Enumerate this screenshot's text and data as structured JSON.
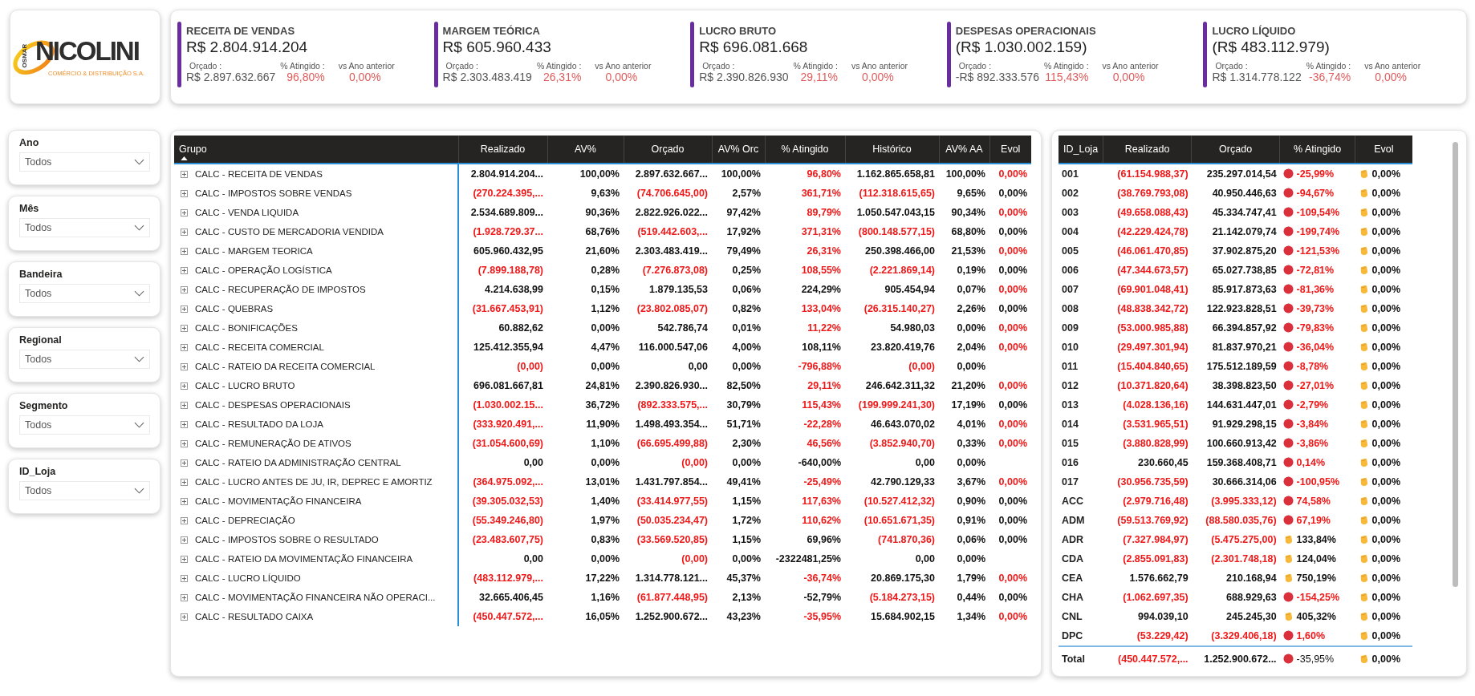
{
  "logo": {
    "prefix": "OSMAR",
    "name": "NICOLINI",
    "tagline": "COMÉRCIO & DISTRIBUIÇÃO S.A."
  },
  "kpis": [
    {
      "title": "RECEITA DE VENDAS",
      "value": "R$ 2.804.914.204",
      "budget_label": "Orçado :",
      "budget": "R$ 2.897.632.667",
      "pct_label": "% Atingido :",
      "pct": "96,80%",
      "prev_label": "vs Ano anterior",
      "prev": "0,00%"
    },
    {
      "title": "MARGEM TEÓRICA",
      "value": "R$ 605.960.433",
      "budget_label": "Orçado :",
      "budget": "R$ 2.303.483.419",
      "pct_label": "% Atingido :",
      "pct": "26,31%",
      "prev_label": "vs Ano anterior",
      "prev": "0,00%"
    },
    {
      "title": "LUCRO BRUTO",
      "value": "R$ 696.081.668",
      "budget_label": "Orçado :",
      "budget": "R$ 2.390.826.930",
      "pct_label": "% Atingido :",
      "pct": "29,11%",
      "prev_label": "vs Ano anterior",
      "prev": "0,00%"
    },
    {
      "title": "DESPESAS OPERACIONAIS",
      "value": "(R$ 1.030.002.159)",
      "budget_label": "Orçado :",
      "budget": "-R$ 892.333.576",
      "pct_label": "% Atingido :",
      "pct": "115,43%",
      "prev_label": "vs Ano anterior",
      "prev": "0,00%"
    },
    {
      "title": "LUCRO LÍQUIDO",
      "value": "(R$ 483.112.979)",
      "budget_label": "Orçado :",
      "budget": "R$ 1.314.778.122",
      "pct_label": "% Atingido :",
      "pct": "-36,74%",
      "prev_label": "vs Ano anterior",
      "prev": "0,00%"
    }
  ],
  "filters": [
    {
      "label": "Ano",
      "value": "Todos"
    },
    {
      "label": "Mês",
      "value": "Todos"
    },
    {
      "label": "Bandeira",
      "value": "Todos"
    },
    {
      "label": "Regional",
      "value": "Todos"
    },
    {
      "label": "Segmento",
      "value": "Todos"
    },
    {
      "label": "ID_Loja",
      "value": "Todos"
    }
  ],
  "main_table": {
    "columns": [
      {
        "label": "Grupo",
        "sorted": true
      },
      {
        "label": "Realizado",
        "sorted": false
      },
      {
        "label": "AV%",
        "sorted": false
      },
      {
        "label": "Orçado",
        "sorted": false
      },
      {
        "label": "AV% Orc",
        "sorted": false
      },
      {
        "label": "% Atingido",
        "sorted": false
      },
      {
        "label": "Histórico",
        "sorted": false
      },
      {
        "label": "AV% AA",
        "sorted": false
      },
      {
        "label": "Evol",
        "sorted": false
      }
    ],
    "rows": [
      {
        "cells": [
          {
            "v": "CALC - RECEITA DE VENDAS",
            "red": false
          },
          {
            "v": "2.804.914.204...",
            "red": false
          },
          {
            "v": "100,00%",
            "red": false
          },
          {
            "v": "2.897.632.667...",
            "red": false
          },
          {
            "v": "100,00%",
            "red": false
          },
          {
            "v": "96,80%",
            "red": true
          },
          {
            "v": "1.162.865.658,81",
            "red": false
          },
          {
            "v": "100,00%",
            "red": false
          },
          {
            "v": "0,00%",
            "red": true
          }
        ]
      },
      {
        "cells": [
          {
            "v": "CALC - IMPOSTOS SOBRE VENDAS",
            "red": false
          },
          {
            "v": "(270.224.395,...",
            "red": true
          },
          {
            "v": "9,63%",
            "red": false
          },
          {
            "v": "(74.706.645,00)",
            "red": true
          },
          {
            "v": "2,57%",
            "red": false
          },
          {
            "v": "361,71%",
            "red": true
          },
          {
            "v": "(112.318.615,65)",
            "red": true
          },
          {
            "v": "9,65%",
            "red": false
          },
          {
            "v": "0,00%",
            "red": false
          }
        ]
      },
      {
        "cells": [
          {
            "v": "CALC - VENDA LIQUIDA",
            "red": false
          },
          {
            "v": "2.534.689.809...",
            "red": false
          },
          {
            "v": "90,36%",
            "red": false
          },
          {
            "v": "2.822.926.022...",
            "red": false
          },
          {
            "v": "97,42%",
            "red": false
          },
          {
            "v": "89,79%",
            "red": true
          },
          {
            "v": "1.050.547.043,15",
            "red": false
          },
          {
            "v": "90,34%",
            "red": false
          },
          {
            "v": "0,00%",
            "red": true
          }
        ]
      },
      {
        "cells": [
          {
            "v": "CALC - CUSTO DE MERCADORIA VENDIDA",
            "red": false
          },
          {
            "v": "(1.928.729.37...",
            "red": true
          },
          {
            "v": "68,76%",
            "red": false
          },
          {
            "v": "(519.442.603,...",
            "red": true
          },
          {
            "v": "17,92%",
            "red": false
          },
          {
            "v": "371,31%",
            "red": true
          },
          {
            "v": "(800.148.577,15)",
            "red": true
          },
          {
            "v": "68,80%",
            "red": false
          },
          {
            "v": "0,00%",
            "red": false
          }
        ]
      },
      {
        "cells": [
          {
            "v": "CALC - MARGEM TEORICA",
            "red": false
          },
          {
            "v": "605.960.432,95",
            "red": false
          },
          {
            "v": "21,60%",
            "red": false
          },
          {
            "v": "2.303.483.419...",
            "red": false
          },
          {
            "v": "79,49%",
            "red": false
          },
          {
            "v": "26,31%",
            "red": true
          },
          {
            "v": "250.398.466,00",
            "red": false
          },
          {
            "v": "21,53%",
            "red": false
          },
          {
            "v": "0,00%",
            "red": true
          }
        ]
      },
      {
        "cells": [
          {
            "v": "CALC - OPERAÇÃO LOGÍSTICA",
            "red": false
          },
          {
            "v": "(7.899.188,78)",
            "red": true
          },
          {
            "v": "0,28%",
            "red": false
          },
          {
            "v": "(7.276.873,08)",
            "red": true
          },
          {
            "v": "0,25%",
            "red": false
          },
          {
            "v": "108,55%",
            "red": true
          },
          {
            "v": "(2.221.869,14)",
            "red": true
          },
          {
            "v": "0,19%",
            "red": false
          },
          {
            "v": "0,00%",
            "red": false
          }
        ]
      },
      {
        "cells": [
          {
            "v": "CALC - RECUPERAÇÃO DE IMPOSTOS",
            "red": false
          },
          {
            "v": "4.214.638,99",
            "red": false
          },
          {
            "v": "0,15%",
            "red": false
          },
          {
            "v": "1.879.135,53",
            "red": false
          },
          {
            "v": "0,06%",
            "red": false
          },
          {
            "v": "224,29%",
            "red": false
          },
          {
            "v": "905.454,94",
            "red": false
          },
          {
            "v": "0,07%",
            "red": false
          },
          {
            "v": "0,00%",
            "red": true
          }
        ]
      },
      {
        "cells": [
          {
            "v": "CALC - QUEBRAS",
            "red": false
          },
          {
            "v": "(31.667.453,91)",
            "red": true
          },
          {
            "v": "1,12%",
            "red": false
          },
          {
            "v": "(23.802.085,07)",
            "red": true
          },
          {
            "v": "0,82%",
            "red": false
          },
          {
            "v": "133,04%",
            "red": true
          },
          {
            "v": "(26.315.140,27)",
            "red": true
          },
          {
            "v": "2,26%",
            "red": false
          },
          {
            "v": "0,00%",
            "red": false
          }
        ]
      },
      {
        "cells": [
          {
            "v": "CALC - BONIFICAÇÕES",
            "red": false
          },
          {
            "v": "60.882,62",
            "red": false
          },
          {
            "v": "0,00%",
            "red": false
          },
          {
            "v": "542.786,74",
            "red": false
          },
          {
            "v": "0,01%",
            "red": false
          },
          {
            "v": "11,22%",
            "red": true
          },
          {
            "v": "54.980,03",
            "red": false
          },
          {
            "v": "0,00%",
            "red": false
          },
          {
            "v": "0,00%",
            "red": true
          }
        ]
      },
      {
        "cells": [
          {
            "v": "CALC - RECEITA COMERCIAL",
            "red": false
          },
          {
            "v": "125.412.355,94",
            "red": false
          },
          {
            "v": "4,47%",
            "red": false
          },
          {
            "v": "116.000.547,06",
            "red": false
          },
          {
            "v": "4,00%",
            "red": false
          },
          {
            "v": "108,11%",
            "red": false
          },
          {
            "v": "23.820.419,76",
            "red": false
          },
          {
            "v": "2,04%",
            "red": false
          },
          {
            "v": "0,00%",
            "red": true
          }
        ]
      },
      {
        "cells": [
          {
            "v": "CALC - RATEIO DA RECEITA COMERCIAL",
            "red": false
          },
          {
            "v": "(0,00)",
            "red": true
          },
          {
            "v": "0,00%",
            "red": false
          },
          {
            "v": "0,00",
            "red": false
          },
          {
            "v": "0,00%",
            "red": false
          },
          {
            "v": "-796,88%",
            "red": true
          },
          {
            "v": "(0,00)",
            "red": true
          },
          {
            "v": "0,00%",
            "red": false
          }
        ]
      },
      {
        "cells": [
          {
            "v": "CALC - LUCRO BRUTO",
            "red": false
          },
          {
            "v": "696.081.667,81",
            "red": false
          },
          {
            "v": "24,81%",
            "red": false
          },
          {
            "v": "2.390.826.930...",
            "red": false
          },
          {
            "v": "82,50%",
            "red": false
          },
          {
            "v": "29,11%",
            "red": true
          },
          {
            "v": "246.642.311,32",
            "red": false
          },
          {
            "v": "21,20%",
            "red": false
          },
          {
            "v": "0,00%",
            "red": true
          }
        ]
      },
      {
        "cells": [
          {
            "v": "CALC - DESPESAS OPERACIONAIS",
            "red": false
          },
          {
            "v": "(1.030.002.15...",
            "red": true
          },
          {
            "v": "36,72%",
            "red": false
          },
          {
            "v": "(892.333.575,...",
            "red": true
          },
          {
            "v": "30,79%",
            "red": false
          },
          {
            "v": "115,43%",
            "red": true
          },
          {
            "v": "(199.999.241,30)",
            "red": true
          },
          {
            "v": "17,19%",
            "red": false
          },
          {
            "v": "0,00%",
            "red": false
          }
        ]
      },
      {
        "cells": [
          {
            "v": "CALC - RESULTADO DA LOJA",
            "red": false
          },
          {
            "v": "(333.920.491,...",
            "red": true
          },
          {
            "v": "11,90%",
            "red": false
          },
          {
            "v": "1.498.493.354...",
            "red": false
          },
          {
            "v": "51,71%",
            "red": false
          },
          {
            "v": "-22,28%",
            "red": true
          },
          {
            "v": "46.643.070,02",
            "red": false
          },
          {
            "v": "4,01%",
            "red": false
          },
          {
            "v": "0,00%",
            "red": true
          }
        ]
      },
      {
        "cells": [
          {
            "v": "CALC - REMUNERAÇÃO DE ATIVOS",
            "red": false
          },
          {
            "v": "(31.054.600,69)",
            "red": true
          },
          {
            "v": "1,10%",
            "red": false
          },
          {
            "v": "(66.695.499,88)",
            "red": true
          },
          {
            "v": "2,30%",
            "red": false
          },
          {
            "v": "46,56%",
            "red": true
          },
          {
            "v": "(3.852.940,70)",
            "red": true
          },
          {
            "v": "0,33%",
            "red": false
          },
          {
            "v": "0,00%",
            "red": true
          }
        ]
      },
      {
        "cells": [
          {
            "v": "CALC - RATEIO DA ADMINISTRAÇÃO CENTRAL",
            "red": false
          },
          {
            "v": "0,00",
            "red": false
          },
          {
            "v": "0,00%",
            "red": false
          },
          {
            "v": "(0,00)",
            "red": true
          },
          {
            "v": "0,00%",
            "red": false
          },
          {
            "v": "-640,00%",
            "red": false
          },
          {
            "v": "0,00",
            "red": false
          },
          {
            "v": "0,00%",
            "red": false
          }
        ]
      },
      {
        "cells": [
          {
            "v": "CALC - LUCRO ANTES DE JU, IR, DEPREC E AMORTIZ",
            "red": false
          },
          {
            "v": "(364.975.092,...",
            "red": true
          },
          {
            "v": "13,01%",
            "red": false
          },
          {
            "v": "1.431.797.854...",
            "red": false
          },
          {
            "v": "49,41%",
            "red": false
          },
          {
            "v": "-25,49%",
            "red": true
          },
          {
            "v": "42.790.129,33",
            "red": false
          },
          {
            "v": "3,67%",
            "red": false
          },
          {
            "v": "0,00%",
            "red": true
          }
        ]
      },
      {
        "cells": [
          {
            "v": "CALC - MOVIMENTAÇÃO FINANCEIRA",
            "red": false
          },
          {
            "v": "(39.305.032,53)",
            "red": true
          },
          {
            "v": "1,40%",
            "red": false
          },
          {
            "v": "(33.414.977,55)",
            "red": true
          },
          {
            "v": "1,15%",
            "red": false
          },
          {
            "v": "117,63%",
            "red": true
          },
          {
            "v": "(10.527.412,32)",
            "red": true
          },
          {
            "v": "0,90%",
            "red": false
          },
          {
            "v": "0,00%",
            "red": false
          }
        ]
      },
      {
        "cells": [
          {
            "v": "CALC - DEPRECIAÇÃO",
            "red": false
          },
          {
            "v": "(55.349.246,80)",
            "red": true
          },
          {
            "v": "1,97%",
            "red": false
          },
          {
            "v": "(50.035.234,47)",
            "red": true
          },
          {
            "v": "1,72%",
            "red": false
          },
          {
            "v": "110,62%",
            "red": true
          },
          {
            "v": "(10.651.671,35)",
            "red": true
          },
          {
            "v": "0,91%",
            "red": false
          },
          {
            "v": "0,00%",
            "red": false
          }
        ]
      },
      {
        "cells": [
          {
            "v": "CALC - IMPOSTOS SOBRE O RESULTADO",
            "red": false
          },
          {
            "v": "(23.483.607,75)",
            "red": true
          },
          {
            "v": "0,83%",
            "red": false
          },
          {
            "v": "(33.569.520,85)",
            "red": true
          },
          {
            "v": "1,15%",
            "red": false
          },
          {
            "v": "69,96%",
            "red": false
          },
          {
            "v": "(741.870,36)",
            "red": true
          },
          {
            "v": "0,06%",
            "red": false
          },
          {
            "v": "0,00%",
            "red": false
          }
        ]
      },
      {
        "cells": [
          {
            "v": "CALC - RATEIO DA MOVIMENTAÇÃO FINANCEIRA",
            "red": false
          },
          {
            "v": "0,00",
            "red": false
          },
          {
            "v": "0,00%",
            "red": false
          },
          {
            "v": "(0,00)",
            "red": true
          },
          {
            "v": "0,00%",
            "red": false
          },
          {
            "v": "-2322481,25%",
            "red": false
          },
          {
            "v": "0,00",
            "red": false
          },
          {
            "v": "0,00%",
            "red": false
          }
        ]
      },
      {
        "cells": [
          {
            "v": "CALC - LUCRO LÍQUIDO",
            "red": false
          },
          {
            "v": "(483.112.979,...",
            "red": true
          },
          {
            "v": "17,22%",
            "red": false
          },
          {
            "v": "1.314.778.121...",
            "red": false
          },
          {
            "v": "45,37%",
            "red": false
          },
          {
            "v": "-36,74%",
            "red": true
          },
          {
            "v": "20.869.175,30",
            "red": false
          },
          {
            "v": "1,79%",
            "red": false
          },
          {
            "v": "0,00%",
            "red": true
          }
        ]
      },
      {
        "cells": [
          {
            "v": "CALC - MOVIMENTAÇÃO FINANCEIRA NÃO OPERACI...",
            "red": false
          },
          {
            "v": "32.665.406,45",
            "red": false
          },
          {
            "v": "1,16%",
            "red": false
          },
          {
            "v": "(61.877.448,95)",
            "red": true
          },
          {
            "v": "2,13%",
            "red": false
          },
          {
            "v": "-52,79%",
            "red": false
          },
          {
            "v": "(5.184.273,15)",
            "red": true
          },
          {
            "v": "0,44%",
            "red": false
          },
          {
            "v": "0,00%",
            "red": false
          }
        ]
      },
      {
        "cells": [
          {
            "v": "CALC - RESULTADO CAIXA",
            "red": false
          },
          {
            "v": "(450.447.572,...",
            "red": true
          },
          {
            "v": "16,05%",
            "red": false
          },
          {
            "v": "1.252.900.672...",
            "red": false
          },
          {
            "v": "43,23%",
            "red": false
          },
          {
            "v": "-35,95%",
            "red": true
          },
          {
            "v": "15.684.902,15",
            "red": false
          },
          {
            "v": "1,34%",
            "red": false
          },
          {
            "v": "0,00%",
            "red": true
          }
        ]
      }
    ]
  },
  "store_table": {
    "columns": [
      "ID_Loja",
      "Realizado",
      "Orçado",
      "% Atingido",
      "Evol"
    ],
    "rows": [
      {
        "id": "001",
        "realizado": {
          "v": "(61.154.988,37)",
          "red": true
        },
        "orcado": {
          "v": "235.297.014,54",
          "red": false
        },
        "atingido": {
          "v": "-25,99%",
          "red": true,
          "kind": "dot"
        },
        "evol": {
          "v": "0,00%",
          "kind": "hands"
        }
      },
      {
        "id": "002",
        "realizado": {
          "v": "(38.769.793,08)",
          "red": true
        },
        "orcado": {
          "v": "40.950.446,63",
          "red": false
        },
        "atingido": {
          "v": "-94,67%",
          "red": true,
          "kind": "dot"
        },
        "evol": {
          "v": "0,00%",
          "kind": "hands"
        }
      },
      {
        "id": "003",
        "realizado": {
          "v": "(49.658.088,43)",
          "red": true
        },
        "orcado": {
          "v": "45.334.747,41",
          "red": false
        },
        "atingido": {
          "v": "-109,54%",
          "red": true,
          "kind": "dot"
        },
        "evol": {
          "v": "0,00%",
          "kind": "hands"
        }
      },
      {
        "id": "004",
        "realizado": {
          "v": "(42.229.424,78)",
          "red": true
        },
        "orcado": {
          "v": "21.142.079,74",
          "red": false
        },
        "atingido": {
          "v": "-199,74%",
          "red": true,
          "kind": "dot"
        },
        "evol": {
          "v": "0,00%",
          "kind": "hands"
        }
      },
      {
        "id": "005",
        "realizado": {
          "v": "(46.061.470,85)",
          "red": true
        },
        "orcado": {
          "v": "37.902.875,20",
          "red": false
        },
        "atingido": {
          "v": "-121,53%",
          "red": true,
          "kind": "dot"
        },
        "evol": {
          "v": "0,00%",
          "kind": "hands"
        }
      },
      {
        "id": "006",
        "realizado": {
          "v": "(47.344.673,57)",
          "red": true
        },
        "orcado": {
          "v": "65.027.738,85",
          "red": false
        },
        "atingido": {
          "v": "-72,81%",
          "red": true,
          "kind": "dot"
        },
        "evol": {
          "v": "0,00%",
          "kind": "hands"
        }
      },
      {
        "id": "007",
        "realizado": {
          "v": "(69.901.048,41)",
          "red": true
        },
        "orcado": {
          "v": "85.917.873,63",
          "red": false
        },
        "atingido": {
          "v": "-81,36%",
          "red": true,
          "kind": "dot"
        },
        "evol": {
          "v": "0,00%",
          "kind": "hands"
        }
      },
      {
        "id": "008",
        "realizado": {
          "v": "(48.838.342,72)",
          "red": true
        },
        "orcado": {
          "v": "122.923.828,51",
          "red": false
        },
        "atingido": {
          "v": "-39,73%",
          "red": true,
          "kind": "dot"
        },
        "evol": {
          "v": "0,00%",
          "kind": "hands"
        }
      },
      {
        "id": "009",
        "realizado": {
          "v": "(53.000.985,88)",
          "red": true
        },
        "orcado": {
          "v": "66.394.857,92",
          "red": false
        },
        "atingido": {
          "v": "-79,83%",
          "red": true,
          "kind": "dot"
        },
        "evol": {
          "v": "0,00%",
          "kind": "hands"
        }
      },
      {
        "id": "010",
        "realizado": {
          "v": "(29.497.301,94)",
          "red": true
        },
        "orcado": {
          "v": "81.837.970,21",
          "red": false
        },
        "atingido": {
          "v": "-36,04%",
          "red": true,
          "kind": "dot"
        },
        "evol": {
          "v": "0,00%",
          "kind": "hands"
        }
      },
      {
        "id": "011",
        "realizado": {
          "v": "(15.404.840,65)",
          "red": true
        },
        "orcado": {
          "v": "175.512.189,59",
          "red": false
        },
        "atingido": {
          "v": "-8,78%",
          "red": true,
          "kind": "dot"
        },
        "evol": {
          "v": "0,00%",
          "kind": "hands"
        }
      },
      {
        "id": "012",
        "realizado": {
          "v": "(10.371.820,64)",
          "red": true
        },
        "orcado": {
          "v": "38.398.823,50",
          "red": false
        },
        "atingido": {
          "v": "-27,01%",
          "red": true,
          "kind": "dot"
        },
        "evol": {
          "v": "0,00%",
          "kind": "hands"
        }
      },
      {
        "id": "013",
        "realizado": {
          "v": "(4.028.136,16)",
          "red": true
        },
        "orcado": {
          "v": "144.631.447,01",
          "red": false
        },
        "atingido": {
          "v": "-2,79%",
          "red": true,
          "kind": "dot"
        },
        "evol": {
          "v": "0,00%",
          "kind": "hands"
        }
      },
      {
        "id": "014",
        "realizado": {
          "v": "(3.531.965,51)",
          "red": true
        },
        "orcado": {
          "v": "91.929.298,15",
          "red": false
        },
        "atingido": {
          "v": "-3,84%",
          "red": true,
          "kind": "dot"
        },
        "evol": {
          "v": "0,00%",
          "kind": "hands"
        }
      },
      {
        "id": "015",
        "realizado": {
          "v": "(3.880.828,99)",
          "red": true
        },
        "orcado": {
          "v": "100.660.913,42",
          "red": false
        },
        "atingido": {
          "v": "-3,86%",
          "red": true,
          "kind": "dot"
        },
        "evol": {
          "v": "0,00%",
          "kind": "hands"
        }
      },
      {
        "id": "016",
        "realizado": {
          "v": "230.660,45",
          "red": false
        },
        "orcado": {
          "v": "159.368.408,71",
          "red": false
        },
        "atingido": {
          "v": "0,14%",
          "red": true,
          "kind": "dot"
        },
        "evol": {
          "v": "0,00%",
          "kind": "hands"
        }
      },
      {
        "id": "017",
        "realizado": {
          "v": "(30.956.735,59)",
          "red": true
        },
        "orcado": {
          "v": "30.666.314,06",
          "red": false
        },
        "atingido": {
          "v": "-100,95%",
          "red": true,
          "kind": "dot"
        },
        "evol": {
          "v": "0,00%",
          "kind": "hands"
        }
      },
      {
        "id": "ACC",
        "realizado": {
          "v": "(2.979.716,48)",
          "red": true
        },
        "orcado": {
          "v": "(3.995.333,12)",
          "red": true
        },
        "atingido": {
          "v": "74,58%",
          "red": true,
          "kind": "dot"
        },
        "evol": {
          "v": "0,00%",
          "kind": "hands"
        }
      },
      {
        "id": "ADM",
        "realizado": {
          "v": "(59.513.769,92)",
          "red": true
        },
        "orcado": {
          "v": "(88.580.035,76)",
          "red": true
        },
        "atingido": {
          "v": "67,19%",
          "red": true,
          "kind": "dot"
        },
        "evol": {
          "v": "0,00%",
          "kind": "hands"
        }
      },
      {
        "id": "ADR",
        "realizado": {
          "v": "(7.327.984,97)",
          "red": true
        },
        "orcado": {
          "v": "(5.475.275,00)",
          "red": true
        },
        "atingido": {
          "v": "133,84%",
          "red": false,
          "kind": "hands"
        },
        "evol": {
          "v": "0,00%",
          "kind": "hands"
        }
      },
      {
        "id": "CDA",
        "realizado": {
          "v": "(2.855.091,83)",
          "red": true
        },
        "orcado": {
          "v": "(2.301.748,18)",
          "red": true
        },
        "atingido": {
          "v": "124,04%",
          "red": false,
          "kind": "hands"
        },
        "evol": {
          "v": "0,00%",
          "kind": "hands"
        }
      },
      {
        "id": "CEA",
        "realizado": {
          "v": "1.576.662,79",
          "red": false
        },
        "orcado": {
          "v": "210.168,94",
          "red": false
        },
        "atingido": {
          "v": "750,19%",
          "red": false,
          "kind": "hands"
        },
        "evol": {
          "v": "0,00%",
          "kind": "hands"
        }
      },
      {
        "id": "CHA",
        "realizado": {
          "v": "(1.062.697,35)",
          "red": true
        },
        "orcado": {
          "v": "688.929,63",
          "red": false
        },
        "atingido": {
          "v": "-154,25%",
          "red": true,
          "kind": "dot"
        },
        "evol": {
          "v": "0,00%",
          "kind": "hands"
        }
      },
      {
        "id": "CNL",
        "realizado": {
          "v": "994.039,10",
          "red": false
        },
        "orcado": {
          "v": "245.245,30",
          "red": false
        },
        "atingido": {
          "v": "405,32%",
          "red": false,
          "kind": "hands"
        },
        "evol": {
          "v": "0,00%",
          "kind": "hands"
        }
      },
      {
        "id": "DPC",
        "realizado": {
          "v": "(53.229,42)",
          "red": true
        },
        "orcado": {
          "v": "(3.329.406,18)",
          "red": true
        },
        "atingido": {
          "v": "1,60%",
          "red": true,
          "kind": "dot"
        },
        "evol": {
          "v": "0,00%",
          "kind": "hands"
        }
      }
    ],
    "total": {
      "id": "Total",
      "realizado": {
        "v": "(450.447.572,...",
        "red": true
      },
      "orcado": {
        "v": "1.252.900.672...",
        "red": false
      },
      "atingido": {
        "v": "-35,95%",
        "red": false,
        "kind": "dot"
      },
      "evol": {
        "v": "0,00%",
        "kind": "hands"
      }
    }
  }
}
